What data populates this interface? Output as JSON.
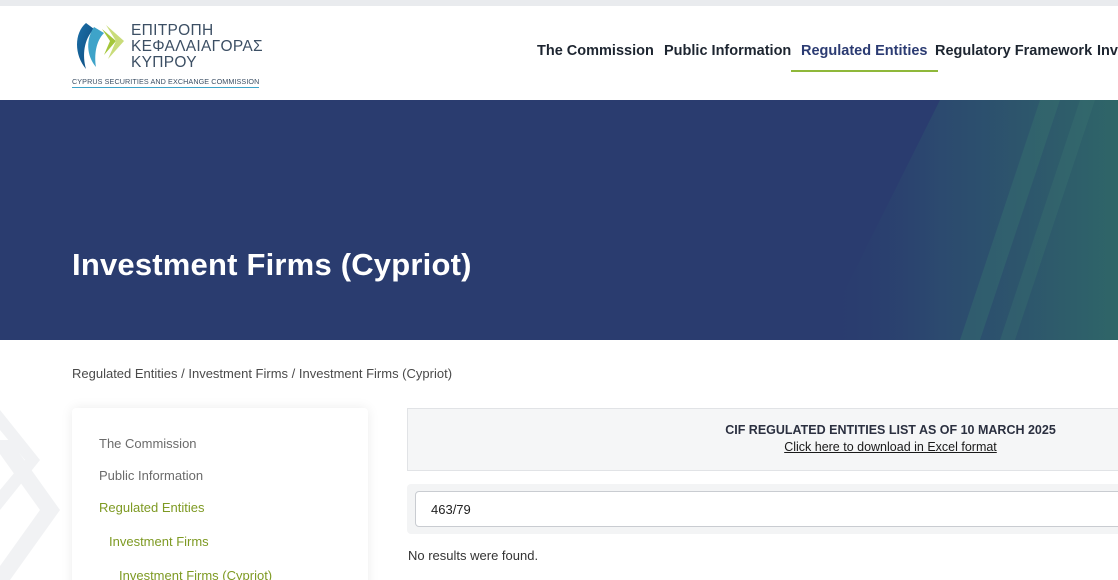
{
  "header": {
    "logo": {
      "greek_line1": "ΕΠΙΤΡΟΠΗ",
      "greek_line2": "ΚΕΦΑΛΑΙΑΓΟΡΑΣ",
      "greek_line3": "ΚΥΠΡΟΥ",
      "english": "CYPRUS SECURITIES AND EXCHANGE COMMISSION"
    },
    "nav": [
      {
        "label": "The Commission",
        "active": false
      },
      {
        "label": "Public Information",
        "active": false
      },
      {
        "label": "Regulated Entities",
        "active": true
      },
      {
        "label": "Regulatory Framework",
        "active": false
      },
      {
        "label": "Inve",
        "active": false
      }
    ]
  },
  "hero": {
    "title": "Investment Firms (Cypriot)"
  },
  "breadcrumb": {
    "items": [
      "Regulated Entities",
      "Investment Firms",
      "Investment Firms (Cypriot)"
    ],
    "separator": " / "
  },
  "sidebar": {
    "items": [
      {
        "label": "The Commission",
        "level": 1
      },
      {
        "label": "Public Information",
        "level": 1
      },
      {
        "label": "Regulated Entities",
        "level": 1
      },
      {
        "label": "Investment Firms",
        "level": 2
      },
      {
        "label": "Investment Firms (Cypriot)",
        "level": 3
      }
    ]
  },
  "notice": {
    "title": "CIF REGULATED ENTITIES LIST AS OF 10 MARCH 2025",
    "link": "Click here to download in Excel format"
  },
  "search": {
    "value": "463/79"
  },
  "results": {
    "message": "No results were found."
  },
  "colors": {
    "hero_bg": "#2a3c6f",
    "accent_green": "#8fb83a",
    "sidebar_active": "#7e9a23",
    "nav_active": "#2b3b72"
  }
}
